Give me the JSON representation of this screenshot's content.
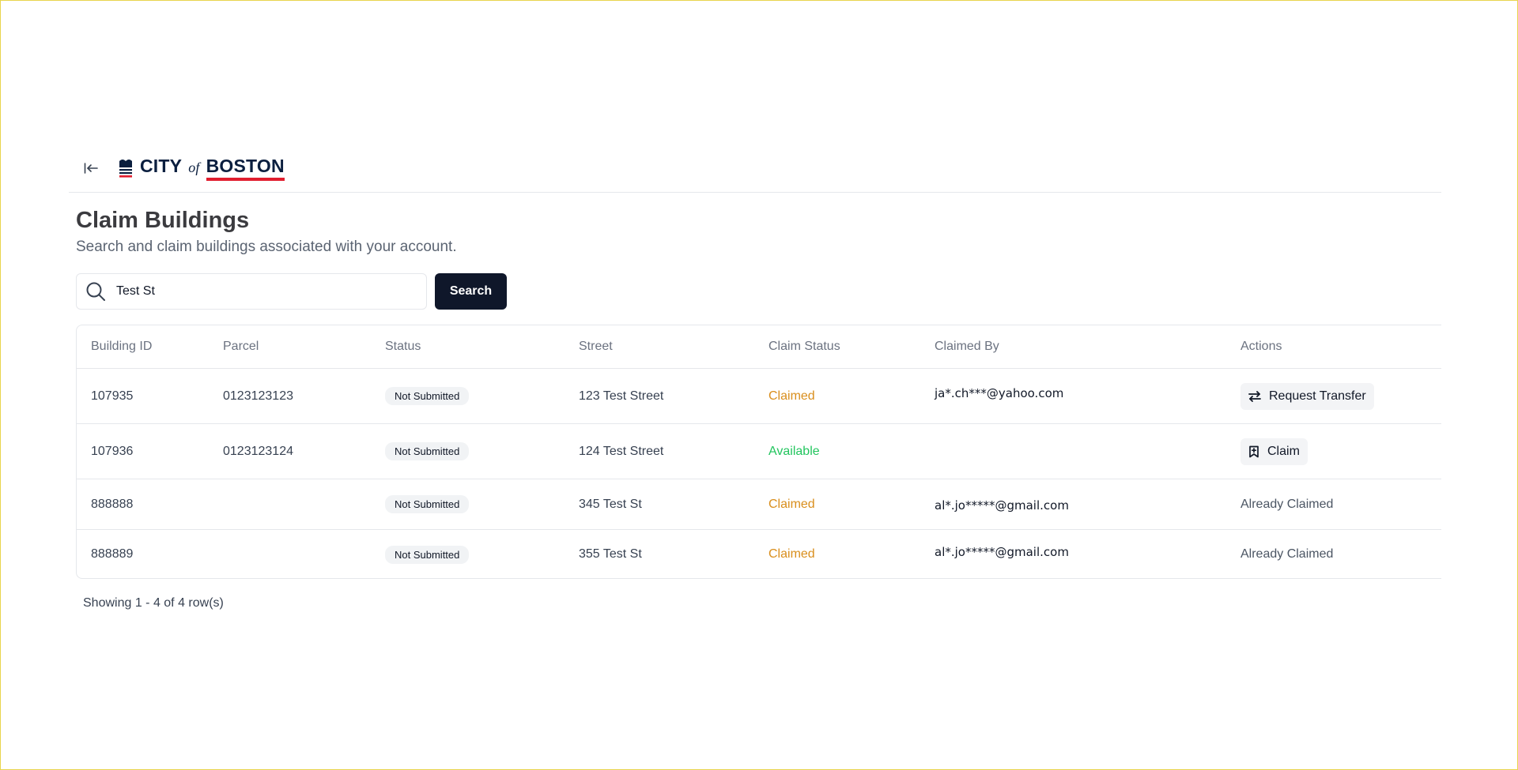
{
  "header": {
    "collapse_icon": "collapse-left-icon",
    "logo": {
      "city": "CITY",
      "of": "of",
      "boston": "BOSTON",
      "emblem_icon": "boston-emblem-icon"
    }
  },
  "page": {
    "title": "Claim Buildings",
    "subtitle": "Search and claim buildings associated with your account."
  },
  "search": {
    "value": "Test St",
    "icon": "search-icon",
    "button_label": "Search"
  },
  "table": {
    "columns": [
      "Building ID",
      "Parcel",
      "Status",
      "Street",
      "Claim Status",
      "Claimed By",
      "Actions"
    ],
    "rows": [
      {
        "building_id": "107935",
        "parcel": "0123123123",
        "status": "Not Submitted",
        "street": "123 Test Street",
        "claim_status": "Claimed",
        "claimed_by": "ja*.ch***@yahoo.com",
        "action": "Request Transfer",
        "action_icon": "transfer-icon"
      },
      {
        "building_id": "107936",
        "parcel": "0123123124",
        "status": "Not Submitted",
        "street": "124 Test Street",
        "claim_status": "Available",
        "claimed_by": "",
        "action": "Claim",
        "action_icon": "bookmark-plus-icon"
      },
      {
        "building_id": "888888",
        "parcel": "",
        "status": "Not Submitted",
        "street": "345 Test St",
        "claim_status": "Claimed",
        "claimed_by": "al*.jo*****@gmail.com",
        "action": "Already Claimed"
      },
      {
        "building_id": "888889",
        "parcel": "",
        "status": "Not Submitted",
        "street": "355 Test St",
        "claim_status": "Claimed",
        "claimed_by": "al*.jo*****@gmail.com",
        "action": "Already Claimed"
      }
    ]
  },
  "pagination": {
    "text": "Showing 1 - 4 of 4 row(s)"
  },
  "colors": {
    "claimed": "#d98e1c",
    "available": "#22c55e",
    "primary_button": "#0f172a",
    "logo_underline": "#e11d2e"
  }
}
